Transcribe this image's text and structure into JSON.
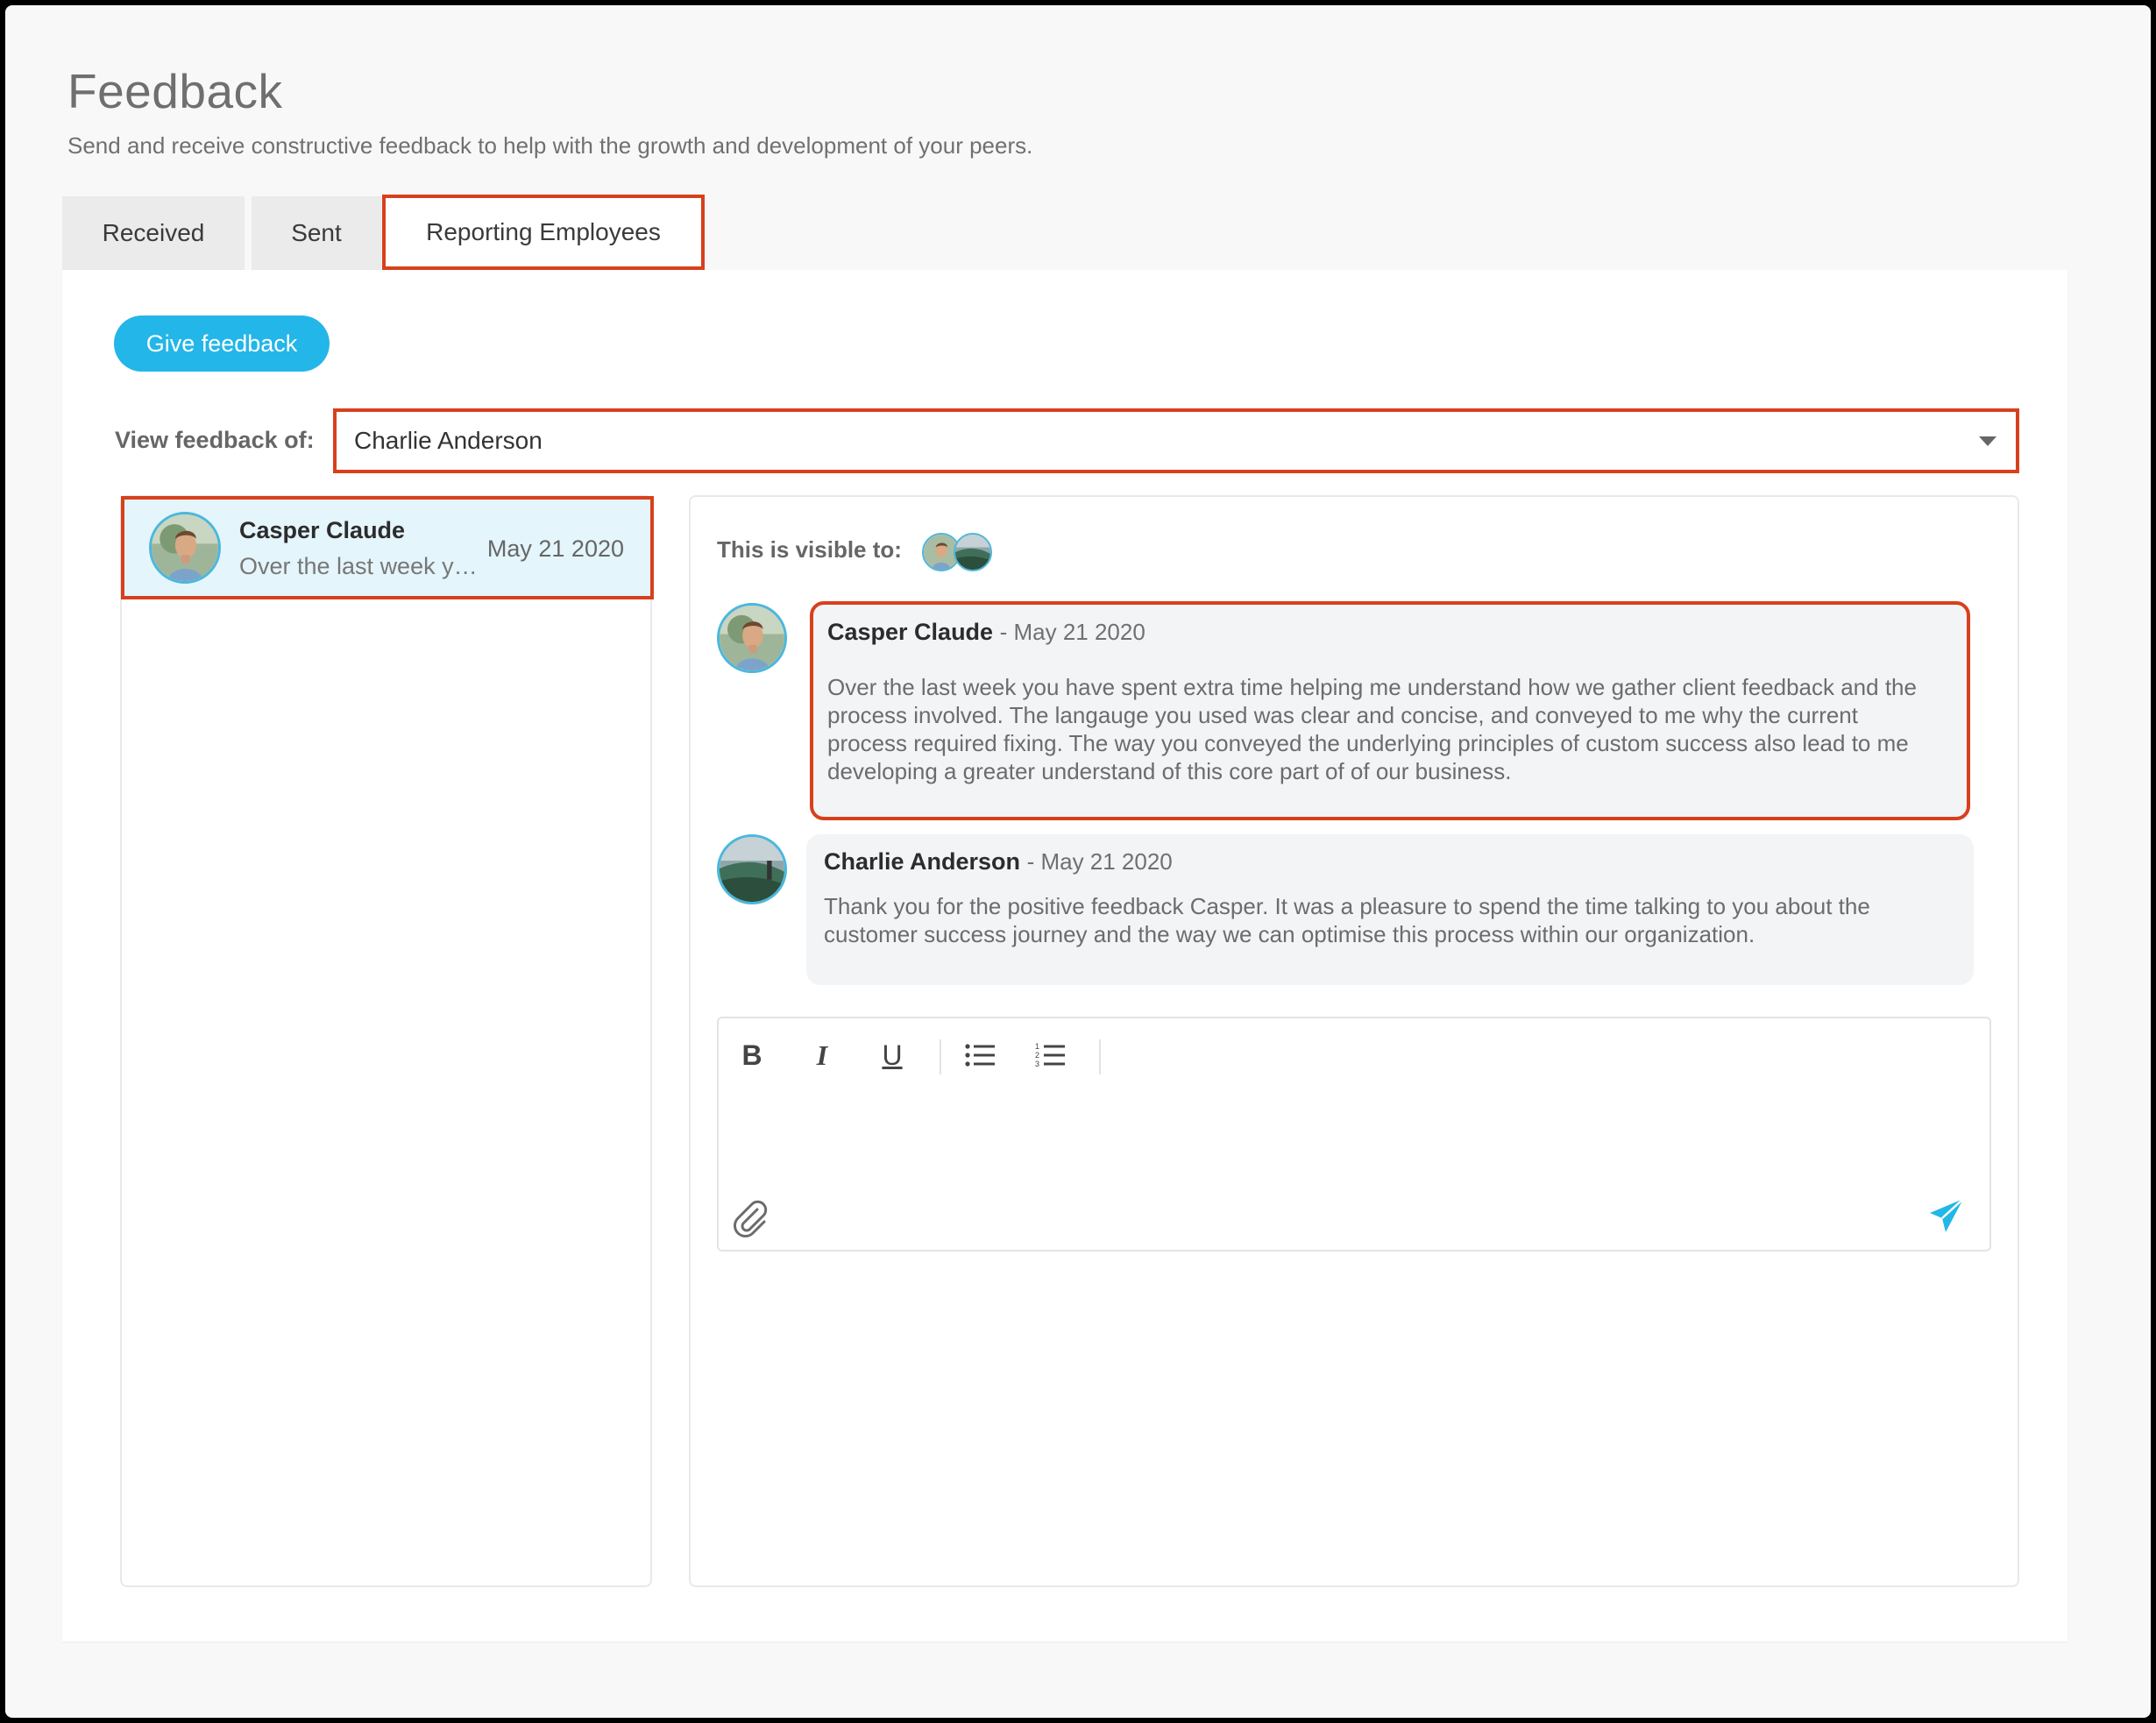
{
  "page": {
    "title": "Feedback",
    "subtitle": "Send and receive constructive feedback to help with the growth and development of your peers."
  },
  "tabs": [
    {
      "label": "Received",
      "active": false
    },
    {
      "label": "Sent",
      "active": false
    },
    {
      "label": "Reporting Employees",
      "active": true
    }
  ],
  "give_feedback_label": "Give feedback",
  "filter": {
    "label": "View feedback of:",
    "selected": "Charlie Anderson"
  },
  "list": [
    {
      "name": "Casper Claude",
      "preview": "Over the last week you have spent extra time helping me understand how we gather client feedback",
      "date": "May 21 2020",
      "selected": true
    }
  ],
  "thread": {
    "visible_label": "This is visible to:",
    "messages": [
      {
        "author": "Casper Claude",
        "date": "- May 21 2020",
        "body": "Over the last week you have spent extra time helping me understand how we gather client feedback and the process involved. The langauge you used was clear and concise, and conveyed to me why the current process required fixing. The way you conveyed the underlying principles of custom success also lead to me developing a greater understand of this core part of of our business."
      },
      {
        "author": "Charlie Anderson",
        "date": "- May 21 2020",
        "body": "Thank you for the positive feedback Casper. It was a pleasure to spend the time talking to you about the customer success journey and the way we can optimise this process within our organization."
      }
    ]
  },
  "editor": {
    "tools": {
      "bold": "B",
      "italic": "I",
      "underline": "U"
    },
    "icons": [
      "bulleted-list-icon",
      "numbered-list-icon",
      "paperclip-icon",
      "send-icon"
    ]
  },
  "colors": {
    "accent": "#23b6e8",
    "highlight_border": "#d8401c",
    "selected_row": "#e4f5fc"
  }
}
